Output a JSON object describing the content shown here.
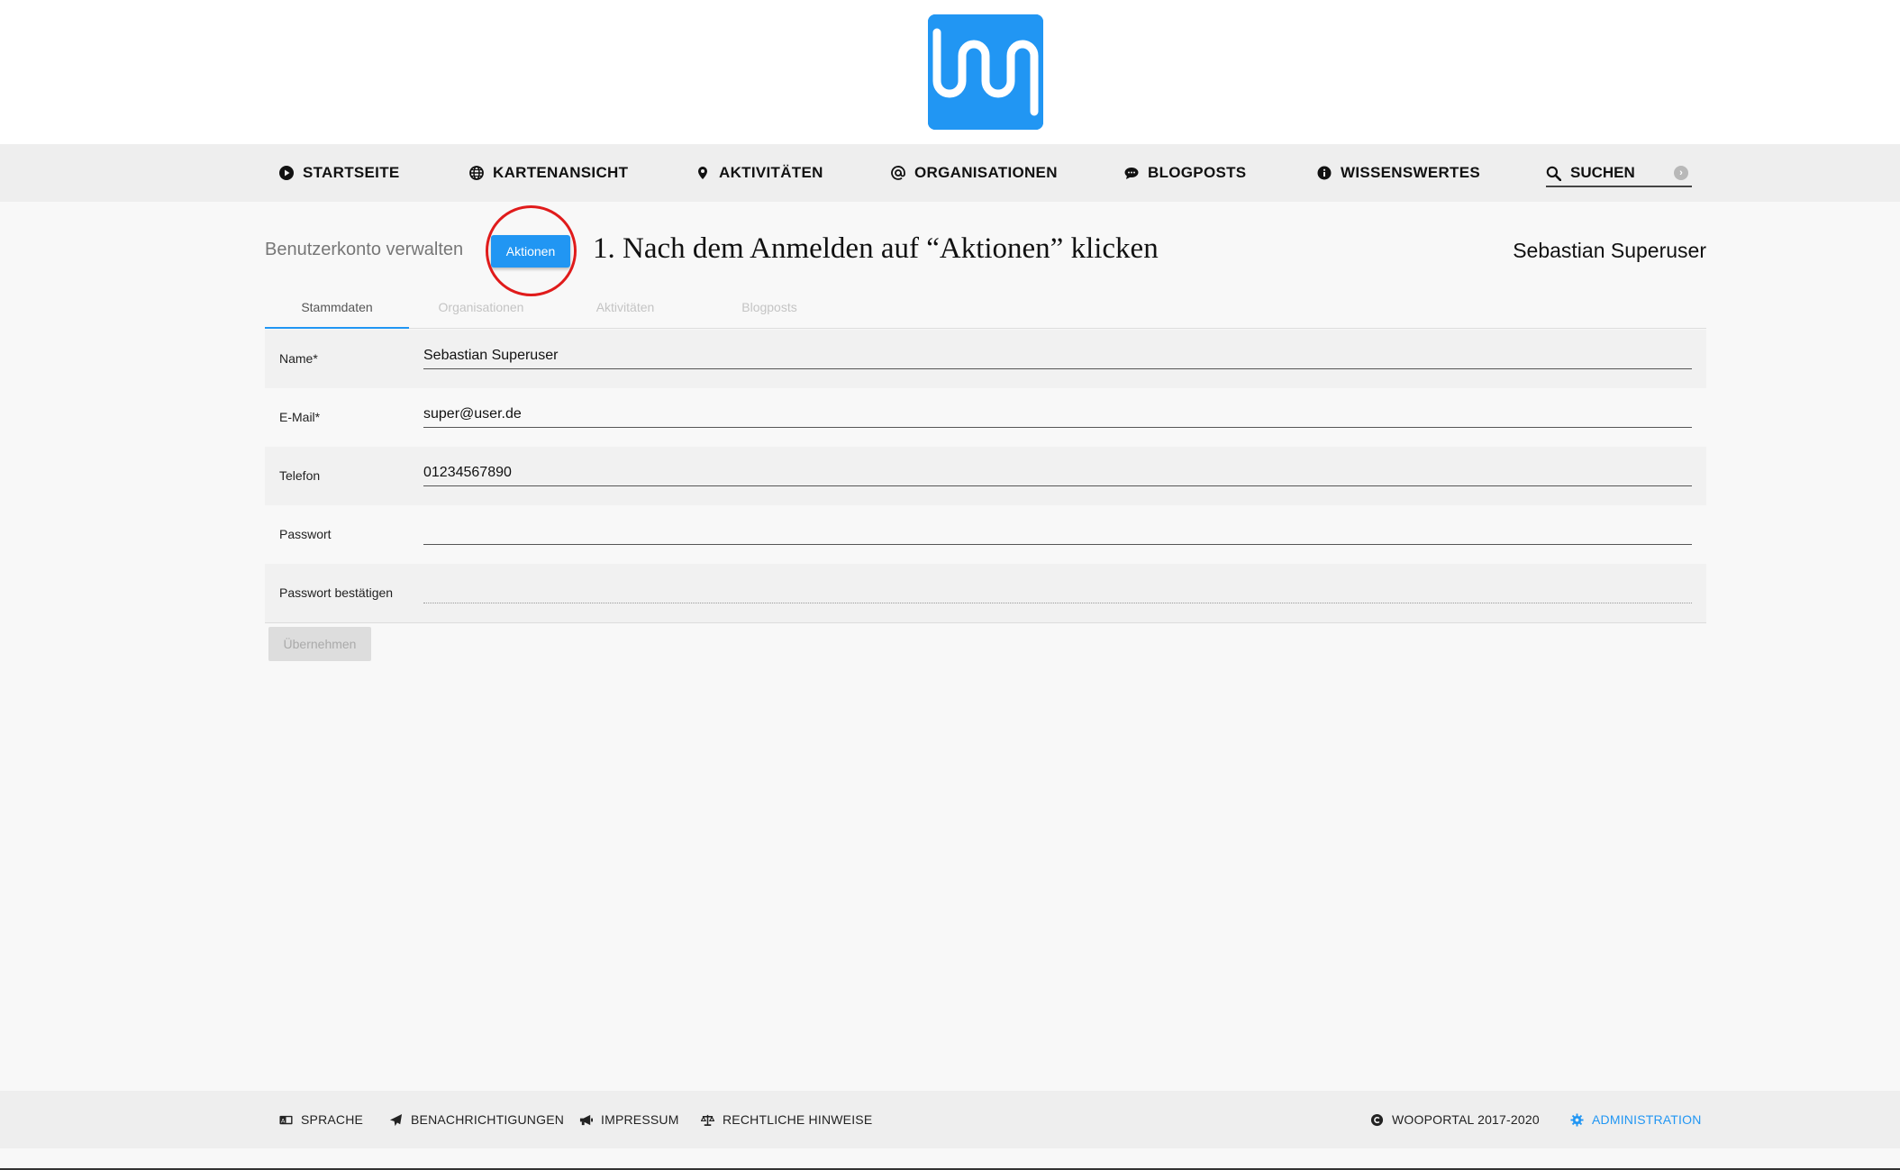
{
  "header": {
    "logo_name": "wooportal-logo",
    "brand_color": "#2196f3"
  },
  "nav": {
    "items": [
      {
        "label": "STARTSEITE",
        "icon": "play-circle-icon"
      },
      {
        "label": "KARTENANSICHT",
        "icon": "globe-icon"
      },
      {
        "label": "AKTIVITÄTEN",
        "icon": "map-marker-icon"
      },
      {
        "label": "ORGANISATIONEN",
        "icon": "at-icon"
      },
      {
        "label": "BLOGPOSTS",
        "icon": "comment-icon"
      },
      {
        "label": "WISSENSWERTES",
        "icon": "info-icon"
      }
    ],
    "search_label": "SUCHEN"
  },
  "page": {
    "heading": "Benutzerkonto verwalten",
    "actions_button": "Aktionen",
    "annotation": "1. Nach dem Anmelden auf “Aktionen” klicken",
    "annotation_color": "#e01b1b",
    "user_name": "Sebastian Superuser"
  },
  "tabs": [
    {
      "label": "Stammdaten",
      "active": true
    },
    {
      "label": "Organisationen",
      "active": false
    },
    {
      "label": "Aktivitäten",
      "active": false
    },
    {
      "label": "Blogposts",
      "active": false
    }
  ],
  "form": {
    "fields": [
      {
        "label": "Name*",
        "value": "Sebastian Superuser"
      },
      {
        "label": "E-Mail*",
        "value": "super@user.de"
      },
      {
        "label": "Telefon",
        "value": "01234567890"
      },
      {
        "label": "Passwort",
        "value": ""
      },
      {
        "label": "Passwort bestätigen",
        "value": ""
      }
    ],
    "submit_label": "Übernehmen"
  },
  "footer": {
    "items": [
      {
        "label": "SPRACHE",
        "icon": "language-icon"
      },
      {
        "label": "BENACHRICHTIGUNGEN",
        "icon": "paper-plane-icon"
      },
      {
        "label": "IMPRESSUM",
        "icon": "bullhorn-icon"
      },
      {
        "label": "RECHTLICHE HINWEISE",
        "icon": "balance-scale-icon"
      }
    ],
    "copyright": "WOOPORTAL 2017-2020",
    "admin_label": "ADMINISTRATION"
  }
}
